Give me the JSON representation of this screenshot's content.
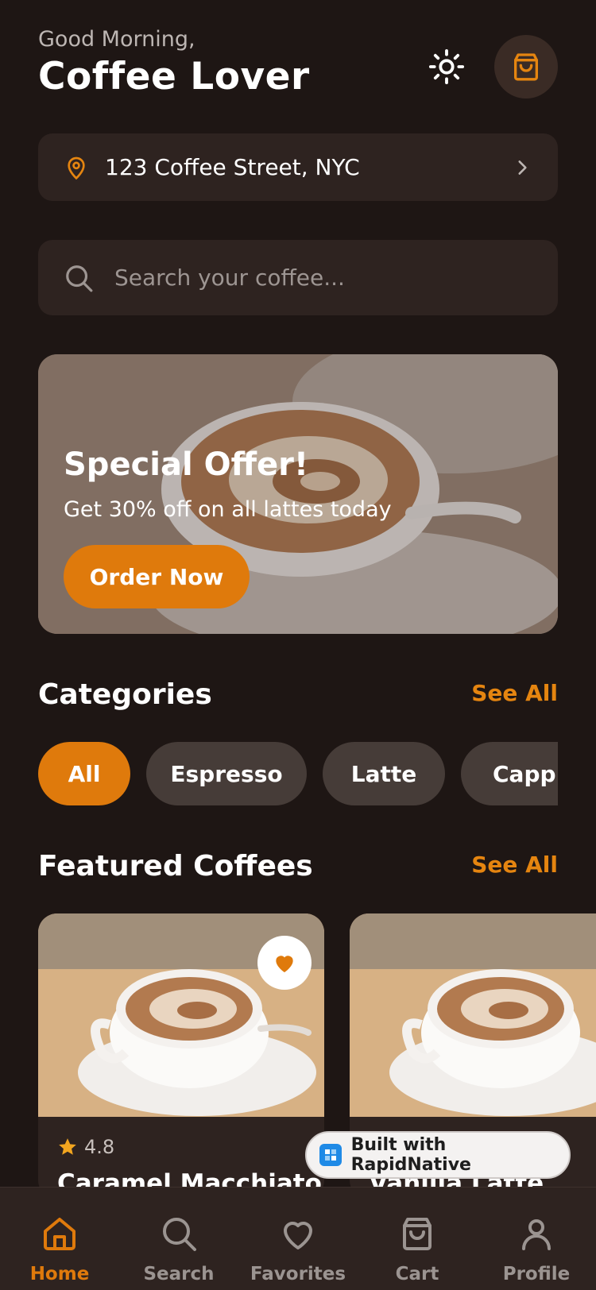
{
  "header": {
    "greeting": "Good Morning,",
    "username": "Coffee Lover",
    "theme_icon": "sun-icon",
    "cart_icon": "shopping-bag-icon"
  },
  "location": {
    "address": "123 Coffee Street, NYC",
    "icon": "map-pin-icon"
  },
  "search": {
    "placeholder": "Search your coffee..."
  },
  "promo": {
    "title": "Special Offer!",
    "subtitle": "Get 30% off on all lattes today",
    "button": "Order Now"
  },
  "categories": {
    "title": "Categories",
    "see_all": "See All",
    "items": [
      {
        "label": "All",
        "active": true
      },
      {
        "label": "Espresso",
        "active": false
      },
      {
        "label": "Latte",
        "active": false
      },
      {
        "label": "Capp",
        "active": false
      }
    ]
  },
  "featured": {
    "title": "Featured Coffees",
    "see_all": "See All",
    "cards": [
      {
        "name": "Caramel Macchiato",
        "rating": "4.8",
        "favorite": true
      },
      {
        "name": "Vanilla Latte",
        "rating": "",
        "favorite": true
      }
    ]
  },
  "badge": {
    "label": "Built with RapidNative"
  },
  "nav": {
    "items": [
      {
        "label": "Home",
        "icon": "home-icon",
        "active": true
      },
      {
        "label": "Search",
        "icon": "search-icon",
        "active": false
      },
      {
        "label": "Favorites",
        "icon": "heart-icon",
        "active": false
      },
      {
        "label": "Cart",
        "icon": "shopping-bag-icon",
        "active": false
      },
      {
        "label": "Profile",
        "icon": "user-icon",
        "active": false
      }
    ]
  },
  "colors": {
    "background": "#1e1614",
    "surface": "#2e2320",
    "accent": "#df7a0c",
    "chip": "#463c38"
  }
}
